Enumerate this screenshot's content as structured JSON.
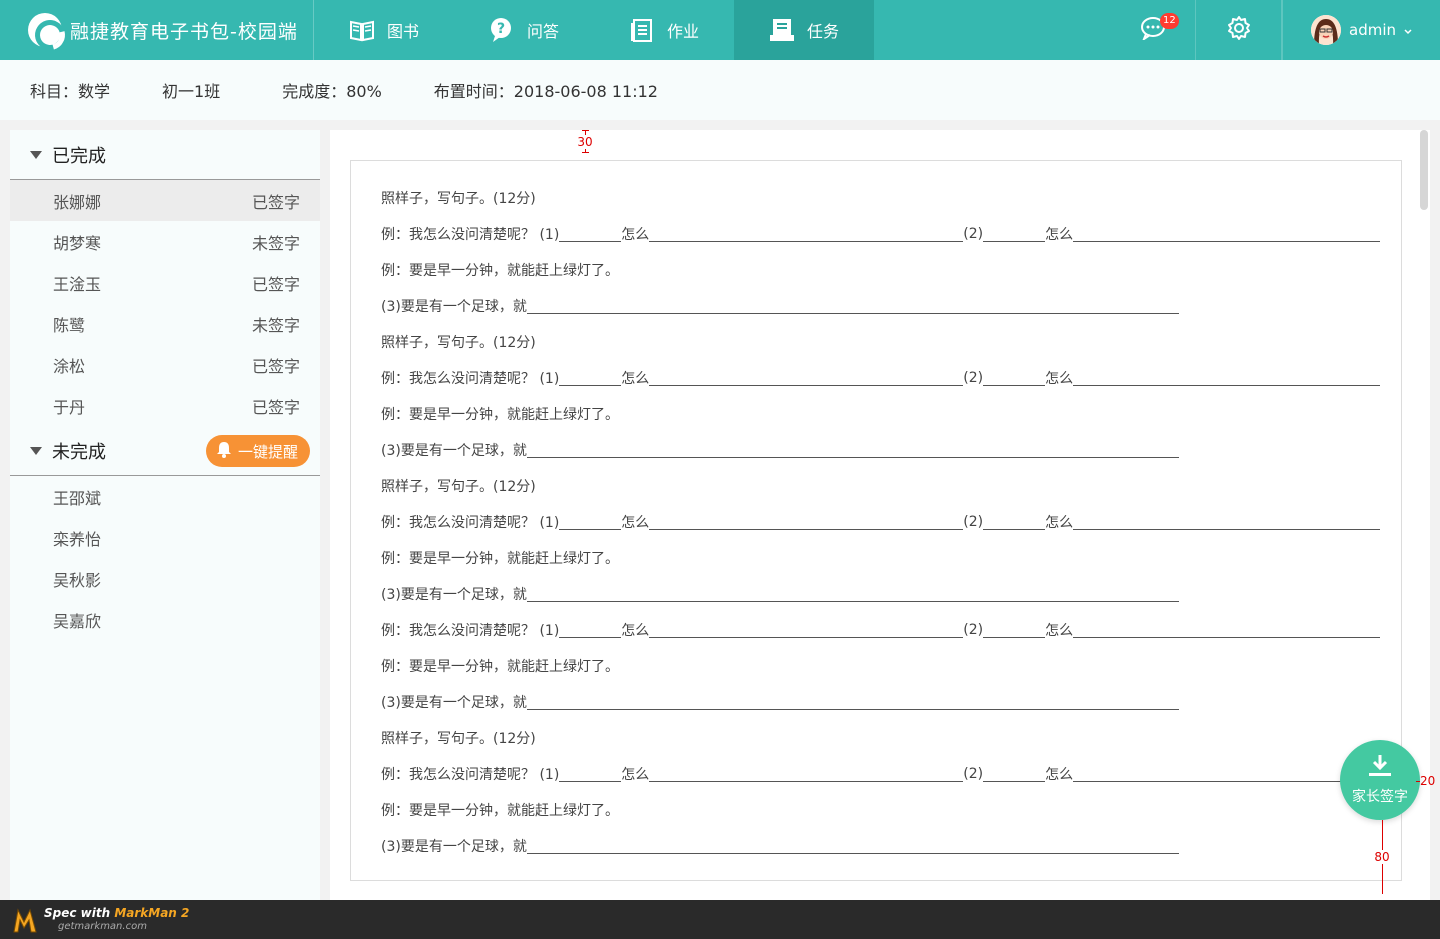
{
  "header": {
    "app_title": "融捷教育电子书包-校园端",
    "nav": [
      {
        "label": "图书",
        "icon": "book-icon"
      },
      {
        "label": "问答",
        "icon": "question-bubble-icon"
      },
      {
        "label": "作业",
        "icon": "homework-icon"
      },
      {
        "label": "任务",
        "icon": "task-icon"
      }
    ],
    "active_nav": "任务",
    "messages_badge": "12",
    "user_name": "admin"
  },
  "info": {
    "subject": "科目：数学",
    "class": "初一1班",
    "completion": "完成度：80%",
    "assigned": "布置时间：2018-06-08  11:12"
  },
  "completed": {
    "title": "已完成",
    "students": [
      {
        "name": "张娜娜",
        "status": "已签字"
      },
      {
        "name": "胡梦寒",
        "status": "未签字"
      },
      {
        "name": "王淦玉",
        "status": "已签字"
      },
      {
        "name": "陈鹭",
        "status": "未签字"
      },
      {
        "name": "涂松",
        "status": "已签字"
      },
      {
        "name": "于丹",
        "status": "已签字"
      }
    ]
  },
  "incomplete": {
    "title": "未完成",
    "remind_label": "一键提醒",
    "students": [
      "王邵斌",
      "栾养怡",
      "吴秋影",
      "吴嘉欣"
    ]
  },
  "doc": {
    "measure_top": "30",
    "lines": [
      {
        "type": "heading",
        "text": "照样子，写句子。(12分)"
      },
      {
        "type": "example",
        "a": "例：我怎么没问清楚呢？ (1)",
        "b": "怎么",
        "c": "(2)",
        "d": "怎么"
      },
      {
        "type": "plain",
        "text": "例：要是早一分钟，就能赶上绿灯了。"
      },
      {
        "type": "fill",
        "text": "(3)要是有一个足球，就"
      },
      {
        "type": "heading",
        "text": "照样子，写句子。(12分)"
      },
      {
        "type": "example",
        "a": "例：我怎么没问清楚呢？ (1)",
        "b": "怎么",
        "c": "(2)",
        "d": "怎么"
      },
      {
        "type": "plain",
        "text": "例：要是早一分钟，就能赶上绿灯了。"
      },
      {
        "type": "fill",
        "text": "(3)要是有一个足球，就"
      },
      {
        "type": "heading",
        "text": "照样子，写句子。(12分)"
      },
      {
        "type": "example",
        "a": "例：我怎么没问清楚呢？ (1)",
        "b": "怎么",
        "c": "(2)",
        "d": "怎么"
      },
      {
        "type": "plain",
        "text": "例：要是早一分钟，就能赶上绿灯了。"
      },
      {
        "type": "fill",
        "text": "(3)要是有一个足球，就"
      },
      {
        "type": "example",
        "a": "例：我怎么没问清楚呢？ (1)",
        "b": "怎么",
        "c": "(2)",
        "d": "怎么"
      },
      {
        "type": "plain",
        "text": "例：要是早一分钟，就能赶上绿灯了。"
      },
      {
        "type": "fill",
        "text": "(3)要是有一个足球，就"
      },
      {
        "type": "heading",
        "text": "照样子，写句子。(12分)"
      },
      {
        "type": "example",
        "a": "例：我怎么没问清楚呢？ (1)",
        "b": "怎么",
        "c": "(2)",
        "d": "怎么"
      },
      {
        "type": "plain",
        "text": "例：要是早一分钟，就能赶上绿灯了。"
      },
      {
        "type": "fill",
        "text": "(3)要是有一个足球，就"
      }
    ]
  },
  "fab": {
    "label": "家长签字"
  },
  "annotations": {
    "right": "20",
    "bottom": "80"
  },
  "footer": {
    "line1_a": "Spec with ",
    "line1_b": "MarkMan 2",
    "line2": "getmarkman.com"
  }
}
